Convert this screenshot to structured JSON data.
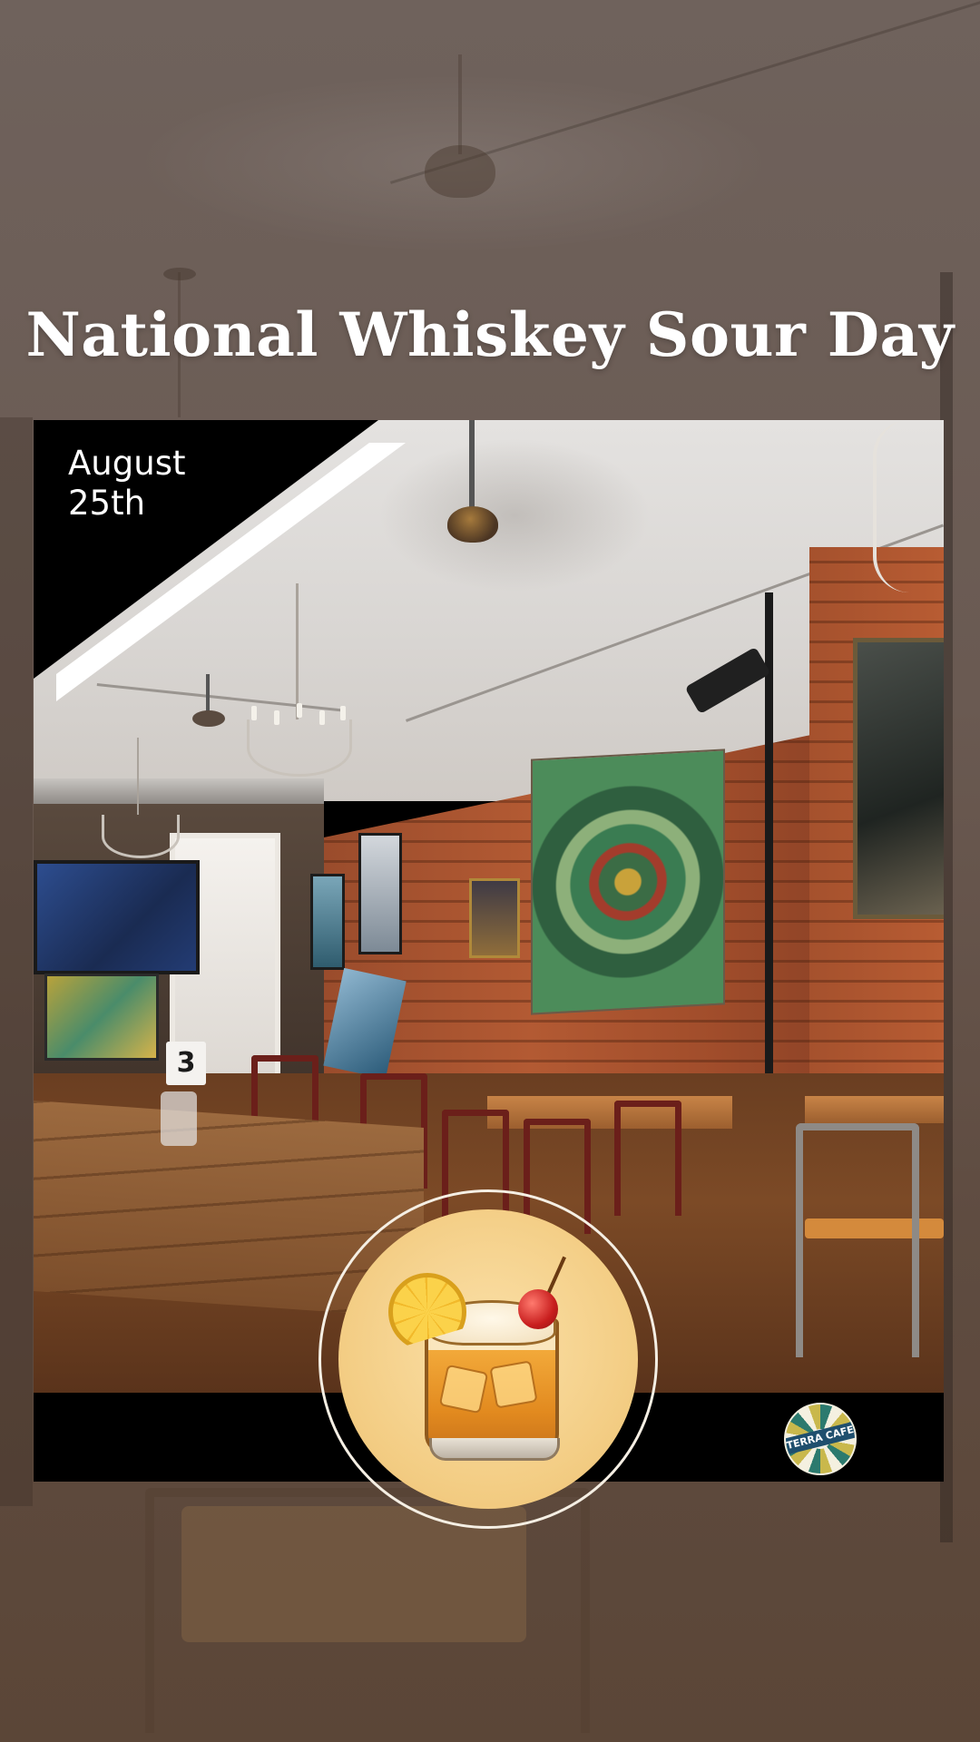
{
  "title": "National Whiskey Sour Day",
  "date": {
    "line1": "August",
    "line2": "25th"
  },
  "photo": {
    "table_number": "3",
    "logo_text": "TERRA CAFE"
  },
  "colors": {
    "title_text": "#ffffff",
    "card_corner": "#000000",
    "bottom_bar": "#000000",
    "badge_fill": "#f3cd84",
    "badge_ring": "#f5efe4"
  },
  "icons": {
    "badge": "whiskey-sour-cocktail-icon",
    "brand": "terra-cafe-logo"
  }
}
